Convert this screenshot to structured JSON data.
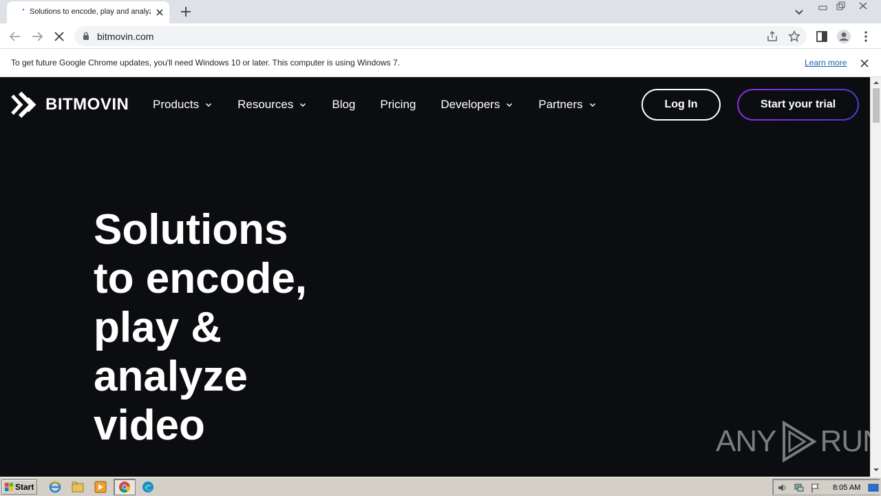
{
  "browser": {
    "tab_title": "Solutions to encode, play and analyze video",
    "url": "bitmovin.com"
  },
  "infobar": {
    "message": "To get future Google Chrome updates, you'll need Windows 10 or later. This computer is using Windows 7.",
    "learn_more": "Learn more"
  },
  "site": {
    "brand": "BITMOVIN",
    "nav": [
      {
        "label": "Products",
        "has_dropdown": true
      },
      {
        "label": "Resources",
        "has_dropdown": true
      },
      {
        "label": "Blog",
        "has_dropdown": false
      },
      {
        "label": "Pricing",
        "has_dropdown": false
      },
      {
        "label": "Developers",
        "has_dropdown": true
      },
      {
        "label": "Partners",
        "has_dropdown": true
      }
    ],
    "login_label": "Log In",
    "trial_label": "Start your trial",
    "hero_lines": [
      "Solutions",
      "to encode,",
      "play &",
      "analyze",
      "video"
    ]
  },
  "watermark": {
    "left": "ANY",
    "right": "RUN"
  },
  "taskbar": {
    "start_label": "Start",
    "clock": "8:05 AM"
  },
  "colors": {
    "page_bg": "#0c0d10",
    "trial_gradient_start": "#8e2de2",
    "trial_gradient_end": "#4a3bd8",
    "link": "#1a5fb4"
  }
}
